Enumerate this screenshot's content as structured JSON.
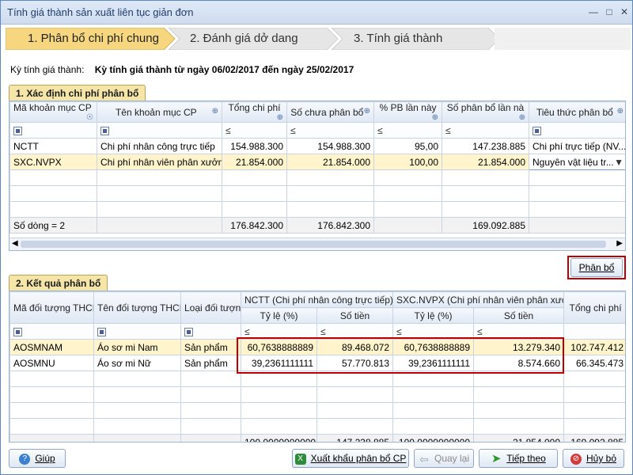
{
  "window": {
    "title": "Tính giá thành sản xuất liên tục giản đơn"
  },
  "wizard": {
    "steps": [
      {
        "label": "1. Phân bổ chi phí chung"
      },
      {
        "label": "2. Đánh giá dở dang"
      },
      {
        "label": "3. Tính giá thành"
      }
    ]
  },
  "period": {
    "label": "Kỳ tính giá thành:",
    "value": "Kỳ tính giá thành từ ngày 06/02/2017 đến ngày 25/02/2017"
  },
  "section1": {
    "title": "1. Xác định chi phí phân bổ",
    "headers": [
      "Mã khoản mục CP",
      "Tên khoản mục CP",
      "Tổng chi phí",
      "Số chưa phân bổ",
      "% PB lần này",
      "Số phân bổ lần nà",
      "Tiêu thức phân bổ"
    ],
    "filter_ops": [
      "≤",
      "≤",
      "≤",
      "≤"
    ],
    "rows": [
      {
        "code": "NCTT",
        "name": "Chi phí nhân công trực tiếp",
        "total": "154.988.300",
        "unallocated": "154.988.300",
        "pct": "95,00",
        "allocated": "147.238.885",
        "criteria": "Chi phí trực tiếp (NV..."
      },
      {
        "code": "SXC.NVPX",
        "name": "Chi phí nhân viên phân xưởng",
        "total": "21.854.000",
        "unallocated": "21.854.000",
        "pct": "100,00",
        "allocated": "21.854.000",
        "criteria": "Nguyên vật liệu tr..."
      }
    ],
    "footer": {
      "count": "Số dòng = 2",
      "total": "176.842.300",
      "unallocated": "176.842.300",
      "allocated": "169.092.885"
    }
  },
  "allocate_button": {
    "label": "Phân bổ"
  },
  "section2": {
    "title": "2. Kết quả phân bổ",
    "headers": {
      "code": "Mã đối tượng THCP",
      "name": "Tên đối tượng THCP",
      "type": "Loại đối tượng",
      "group1": "NCTT (Chi phí nhân công trực tiếp)",
      "group2": "SXC.NVPX (Chi phí nhân viên phân xưởng",
      "ratio": "Tỷ lệ (%)",
      "amount": "Số tiền",
      "total": "Tổng chi phí"
    },
    "filter_ops": [
      "≤",
      "≤",
      "≤",
      "≤"
    ],
    "rows": [
      {
        "code": "AOSMNAM",
        "name": "Áo sơ mi Nam",
        "type": "Sản phẩm",
        "r1": "60,7638888889",
        "a1": "89.468.072",
        "r2": "60,7638888889",
        "a2": "13.279.340",
        "total": "102.747.412"
      },
      {
        "code": "AOSMNU",
        "name": "Áo sơ mi Nữ",
        "type": "Sản phẩm",
        "r1": "39,2361111111",
        "a1": "57.770.813",
        "r2": "39,2361111111",
        "a2": "8.574.660",
        "total": "66.345.473"
      }
    ],
    "footer": {
      "r1": "100,0000000000",
      "a1": "147.238.885",
      "r2": "100,0000000000",
      "a2": "21.854.000",
      "total": "169.092.885"
    }
  },
  "buttons": {
    "help": "Giúp",
    "export": "Xuất khẩu phân bổ CP",
    "back": "Quay lại",
    "next": "Tiếp theo",
    "cancel": "Hủy bỏ"
  },
  "colors": {
    "accent": "#f5d67a",
    "highlight": "#c00000",
    "row_selected": "#fff4cc"
  }
}
